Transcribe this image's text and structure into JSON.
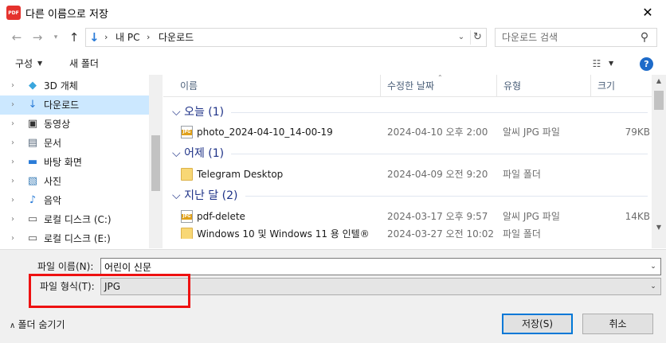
{
  "window": {
    "app_icon_text": "PDF",
    "title": "다른 이름으로 저장",
    "close_glyph": "✕"
  },
  "address": {
    "crumbs": [
      "내 PC",
      "다운로드"
    ],
    "separator": "›",
    "search_placeholder": "다운로드 검색"
  },
  "toolbar": {
    "organize_label": "구성",
    "new_folder_label": "새 폴더",
    "help_glyph": "?"
  },
  "nav": {
    "items": [
      {
        "label": "3D 개체",
        "icon": "cube-icon",
        "glyph": "◆",
        "color": "#3aa6dd",
        "selected": false
      },
      {
        "label": "다운로드",
        "icon": "download-icon",
        "glyph": "↓",
        "color": "#2a7bd7",
        "selected": true
      },
      {
        "label": "동영상",
        "icon": "video-icon",
        "glyph": "▣",
        "color": "#333333",
        "selected": false
      },
      {
        "label": "문서",
        "icon": "document-icon",
        "glyph": "▤",
        "color": "#5a6b7e",
        "selected": false
      },
      {
        "label": "바탕 화면",
        "icon": "desktop-icon",
        "glyph": "▬",
        "color": "#2a7bd7",
        "selected": false
      },
      {
        "label": "사진",
        "icon": "pictures-icon",
        "glyph": "▧",
        "color": "#3d7fb8",
        "selected": false
      },
      {
        "label": "음악",
        "icon": "music-icon",
        "glyph": "♪",
        "color": "#2a7bd7",
        "selected": false
      },
      {
        "label": "로컬 디스크 (C:)",
        "icon": "drive-c-icon",
        "glyph": "▭",
        "color": "#555555",
        "selected": false
      },
      {
        "label": "로컬 디스크 (E:)",
        "icon": "drive-e-icon",
        "glyph": "▭",
        "color": "#555555",
        "selected": false
      }
    ]
  },
  "columns": {
    "name": "이름",
    "modified": "수정한 날짜",
    "type": "유형",
    "size": "크기"
  },
  "groups": [
    {
      "label": "오늘 (1)"
    },
    {
      "label": "어제 (1)"
    },
    {
      "label": "지난 달 (2)"
    }
  ],
  "files": [
    {
      "name": "photo_2024-04-10_14-00-19",
      "modified": "2024-04-10 오후 2:00",
      "type": "알씨 JPG 파일",
      "size": "79KB",
      "kind": "jpg"
    },
    {
      "name": "Telegram Desktop",
      "modified": "2024-04-09 오전 9:20",
      "type": "파일 폴더",
      "size": "",
      "kind": "folder"
    },
    {
      "name": "pdf-delete",
      "modified": "2024-03-17 오후 9:57",
      "type": "알씨 JPG 파일",
      "size": "14KB",
      "kind": "jpg"
    },
    {
      "name": "Windows 10 및 Windows 11 용 인텔®",
      "modified": "2024-03-27 오전 10:02",
      "type": "파일 폴더",
      "size": "",
      "kind": "folder"
    }
  ],
  "form": {
    "filename_label": "파일 이름(N):",
    "filename_value": "어린이 신문",
    "filetype_label": "파일 형식(T):",
    "filetype_value": "JPG",
    "hide_folders_label": "폴더 숨기기",
    "save_label": "저장(S)",
    "cancel_label": "취소"
  },
  "colors": {
    "highlight_box": "#ee1111",
    "selected_nav": "#cce8ff",
    "group_header": "#1e3287",
    "help_badge": "#1e6bc9"
  }
}
